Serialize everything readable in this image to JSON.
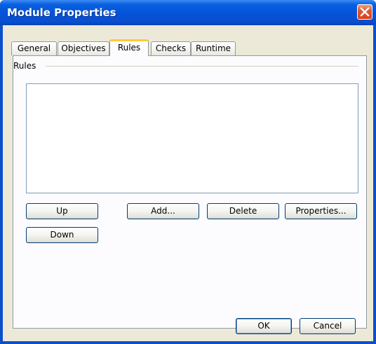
{
  "window": {
    "title": "Module Properties"
  },
  "tabs": [
    {
      "label": "General"
    },
    {
      "label": "Objectives"
    },
    {
      "label": "Rules",
      "active": true
    },
    {
      "label": "Checks"
    },
    {
      "label": "Runtime"
    }
  ],
  "rules_panel": {
    "group_label": "Rules",
    "items": [],
    "buttons": {
      "up": "Up",
      "down": "Down",
      "add": "Add...",
      "delete": "Delete",
      "properties": "Properties..."
    }
  },
  "footer": {
    "ok": "OK",
    "cancel": "Cancel"
  },
  "colors": {
    "titlebar": "#0452d8",
    "dialog_background": "#ece9d8",
    "panel_background": "#fcfcfe",
    "active_tab_accent": "#ffc83c",
    "close_button": "#e2572d"
  },
  "icons": {
    "close": "close-icon"
  }
}
